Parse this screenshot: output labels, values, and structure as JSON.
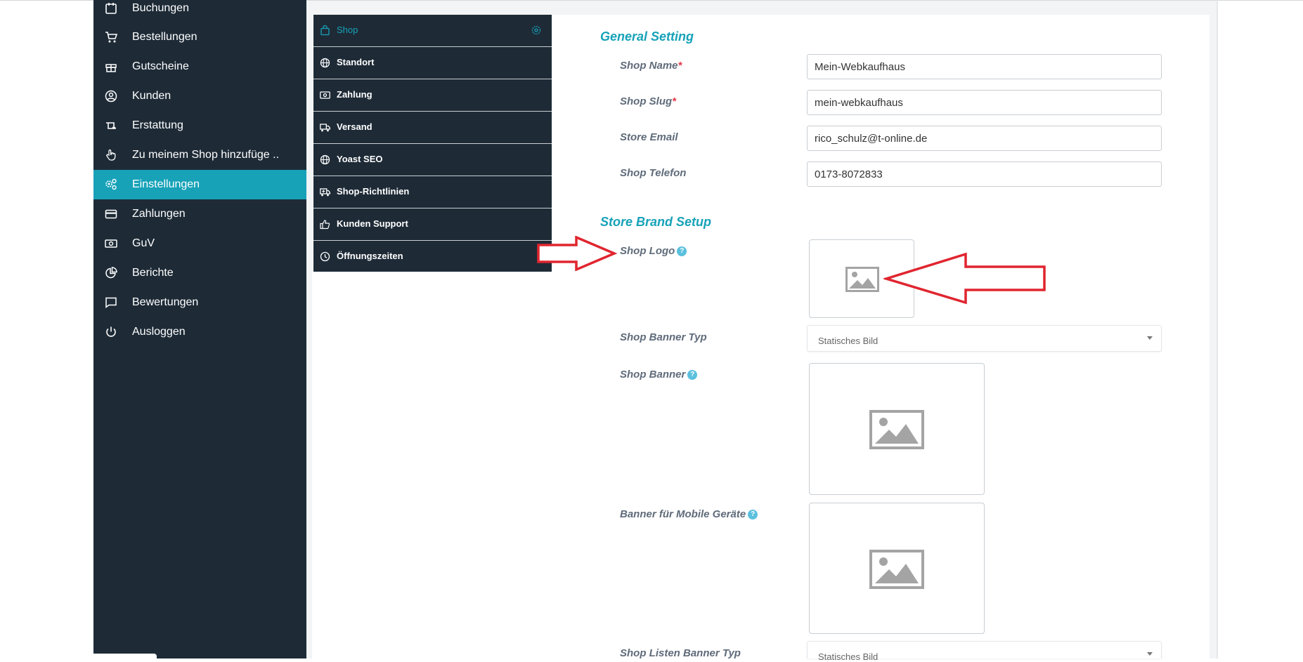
{
  "sidebar": {
    "items": [
      {
        "label": "Buchungen",
        "icon": "calendar-icon"
      },
      {
        "label": "Bestellungen",
        "icon": "cart-icon"
      },
      {
        "label": "Gutscheine",
        "icon": "gift-icon"
      },
      {
        "label": "Kunden",
        "icon": "user-circle-icon"
      },
      {
        "label": "Erstattung",
        "icon": "refund-icon"
      },
      {
        "label": "Zu meinem Shop hinzufüge ..",
        "icon": "hand-pointer-icon"
      },
      {
        "label": "Einstellungen",
        "icon": "gears-icon",
        "active": true
      },
      {
        "label": "Zahlungen",
        "icon": "credit-card-icon"
      },
      {
        "label": "GuV",
        "icon": "money-icon"
      },
      {
        "label": "Berichte",
        "icon": "pie-chart-icon"
      },
      {
        "label": "Bewertungen",
        "icon": "comment-icon"
      },
      {
        "label": "Ausloggen",
        "icon": "power-icon"
      }
    ]
  },
  "settings_menu": {
    "items": [
      {
        "label": "Shop",
        "icon": "shopping-bag-icon",
        "active": true
      },
      {
        "label": "Standort",
        "icon": "globe-icon"
      },
      {
        "label": "Zahlung",
        "icon": "money-icon"
      },
      {
        "label": "Versand",
        "icon": "truck-icon"
      },
      {
        "label": "Yoast SEO",
        "icon": "globe-icon"
      },
      {
        "label": "Shop-Richtlinien",
        "icon": "ambulance-icon"
      },
      {
        "label": "Kunden Support",
        "icon": "thumbs-up-icon"
      },
      {
        "label": "Öffnungszeiten",
        "icon": "clock-icon"
      }
    ]
  },
  "general": {
    "title": "General Setting",
    "shop_name_label": "Shop Name",
    "shop_name_value": "Mein-Webkaufhaus",
    "shop_slug_label": "Shop Slug",
    "shop_slug_value": "mein-webkaufhaus",
    "store_email_label": "Store Email",
    "store_email_value": "rico_schulz@t-online.de",
    "shop_telefon_label": "Shop Telefon",
    "shop_telefon_value": "0173-8072833",
    "required_mark": "*"
  },
  "brand": {
    "title": "Store Brand Setup",
    "shop_logo_label": "Shop Logo",
    "shop_banner_typ_label": "Shop Banner Typ",
    "shop_banner_typ_value": "Statisches Bild",
    "shop_banner_label": "Shop Banner",
    "mobile_banner_label": "Banner für Mobile Geräte",
    "listen_banner_typ_label": "Shop Listen Banner Typ",
    "listen_banner_typ_value": "Statisches Bild",
    "info_glyph": "?"
  },
  "colors": {
    "sidebar_bg": "#1e2b37",
    "accent": "#17a2b8",
    "annotation_arrow": "#e0252f",
    "required": "#e53946"
  }
}
